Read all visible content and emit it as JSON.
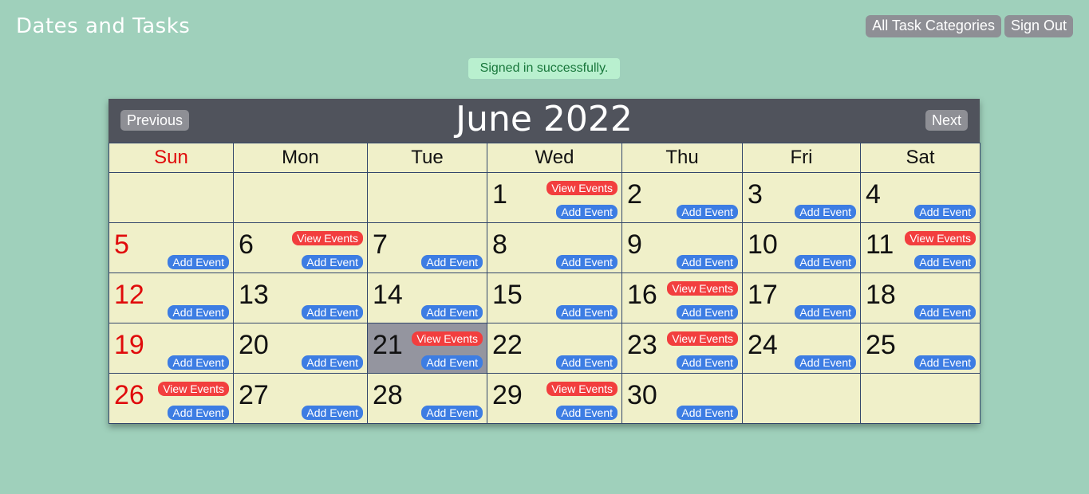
{
  "app": {
    "title": "Dates and Tasks",
    "categories_button": "All Task Categories",
    "signout_button": "Sign Out"
  },
  "flash": {
    "message": "Signed in successfully."
  },
  "calendar": {
    "title": "June 2022",
    "prev_label": "Previous",
    "next_label": "Next",
    "weekdays": [
      "Sun",
      "Mon",
      "Tue",
      "Wed",
      "Thu",
      "Fri",
      "Sat"
    ],
    "view_label": "View Events",
    "add_label": "Add Event",
    "first_weekday": 3,
    "days_in_month": 30,
    "today": 21,
    "days_with_events": [
      1,
      6,
      11,
      16,
      21,
      23,
      26,
      29
    ],
    "colors": {
      "background": "#9fd0bb",
      "header": "#50535c",
      "cell": "#f0f0c9",
      "today_cell": "#94959f",
      "sunday_text": "#e00b0b",
      "view_events": "#f23e3e",
      "add_event": "#3d7de3",
      "flash_bg": "#b9f0cf",
      "flash_text": "#18773b"
    }
  }
}
